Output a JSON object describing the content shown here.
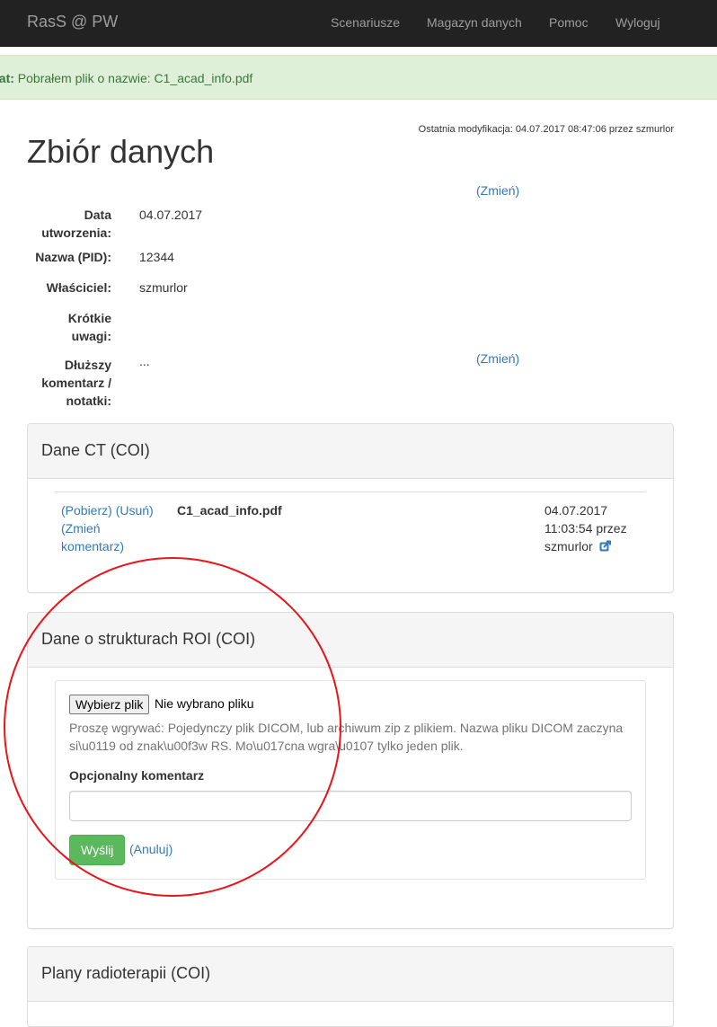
{
  "navbar": {
    "brand": "RasS @ PW",
    "items": [
      "Scenariusze",
      "Magazyn danych",
      "Pomoc",
      "Wyloguj"
    ]
  },
  "alert": {
    "strong": "kat:",
    "message": "Pobrałem plik o nazwie: C1_acad_info.pdf"
  },
  "last_modified": "Ostatnia modyfikacja: 04.07.2017 08:47:06 przez szmurlor",
  "page_title": "Zbiór danych",
  "change_link": "(Zmień)",
  "fields": {
    "created_label_1": "Data",
    "created_label_2": "utworzenia:",
    "created_value": "04.07.2017",
    "name_label": "Nazwa (PID):",
    "name_value": "12344",
    "owner_label": "Właściciel:",
    "owner_value": "szmurlor",
    "short_label_1": "Krótkie",
    "short_label_2": "uwagi:",
    "short_value": "",
    "long_label_1": "Dłuższy",
    "long_label_2": "komentarz /",
    "long_label_3": "notatki:",
    "long_value": "..."
  },
  "panel_ct": {
    "title": "Dane CT (COI)",
    "download": "(Pobierz)",
    "remove": "(Usuń)",
    "change_comment_1": "(Zmień",
    "change_comment_2": "komentarz)",
    "file_name": "C1_acad_info.pdf",
    "date_line_1": "04.07.2017",
    "date_line_2": "11:03:54 przez",
    "date_line_3": "szmurlor",
    "ext_icon": "external-link-icon"
  },
  "panel_roi": {
    "title": "Dane o strukturach ROI (COI)",
    "choose_file": "Wybierz plik",
    "no_file": "Nie wybrano pliku",
    "help": "Proszę wgrywać: Pojedynczy plik DICOM, lub archiwum zip z plikiem. Nazwa pliku DICOM zaczyna si\\u0119 od znak\\u00f3w RS. Mo\\u017cna wgra\\u0107 tylko jeden plik.",
    "comment_label": "Opcjonalny komentarz",
    "comment_value": "",
    "send": "Wyślij",
    "cancel": "(Anuluj)"
  },
  "panel_plans": {
    "title": "Plany radioterapii (COI)"
  },
  "colors": {
    "navbar_bg": "#222222",
    "alert_bg": "#dff0d8",
    "link": "#337ab7",
    "success": "#5cb85c",
    "annotation_circle": "#e8151a"
  }
}
